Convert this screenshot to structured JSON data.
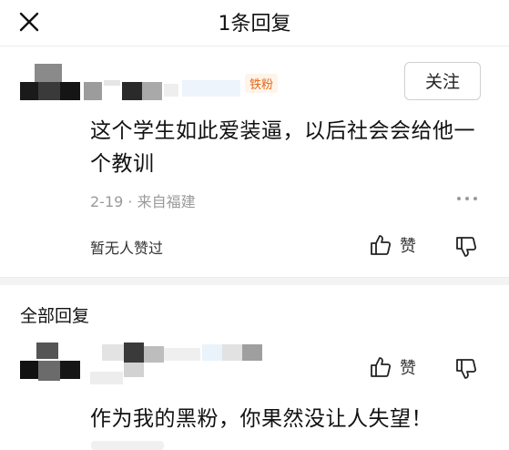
{
  "header": {
    "title": "1条回复"
  },
  "comment": {
    "badge": "铁粉",
    "follow_label": "关注",
    "text": "这个学生如此爱装逼，以后社会会给他一个教训",
    "date": "2-19",
    "separator": "·",
    "location": "来自福建",
    "no_likes": "暂无人赞过",
    "like_label": "赞"
  },
  "replies": {
    "section_title": "全部回复",
    "items": [
      {
        "text": "作为我的黑粉，你果然没让人失望！",
        "like_label": "赞"
      }
    ]
  },
  "icons": {
    "close": "close-icon",
    "more": "more-icon",
    "like": "thumbs-up-icon",
    "dislike": "thumbs-down-icon"
  },
  "colors": {
    "badge": "#e0691d",
    "meta_text": "#9a9a9a",
    "divider": "#f3f3f3"
  }
}
